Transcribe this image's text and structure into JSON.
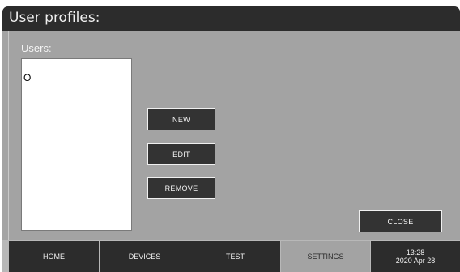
{
  "title": "User profiles:",
  "users": {
    "label": "Users:",
    "items": [
      "O"
    ]
  },
  "buttons": {
    "new": "NEW",
    "edit": "EDIT",
    "remove": "REMOVE",
    "close": "CLOSE"
  },
  "nav": {
    "tabs": [
      {
        "label": "HOME"
      },
      {
        "label": "DEVICES"
      },
      {
        "label": "TEST"
      },
      {
        "label": "SETTINGS",
        "active": true
      }
    ],
    "time": "13:28",
    "date": "2020 Apr 28"
  },
  "colors": {
    "background": "#a3a3a3",
    "bar": "#2c2c2c",
    "button": "#333333"
  }
}
